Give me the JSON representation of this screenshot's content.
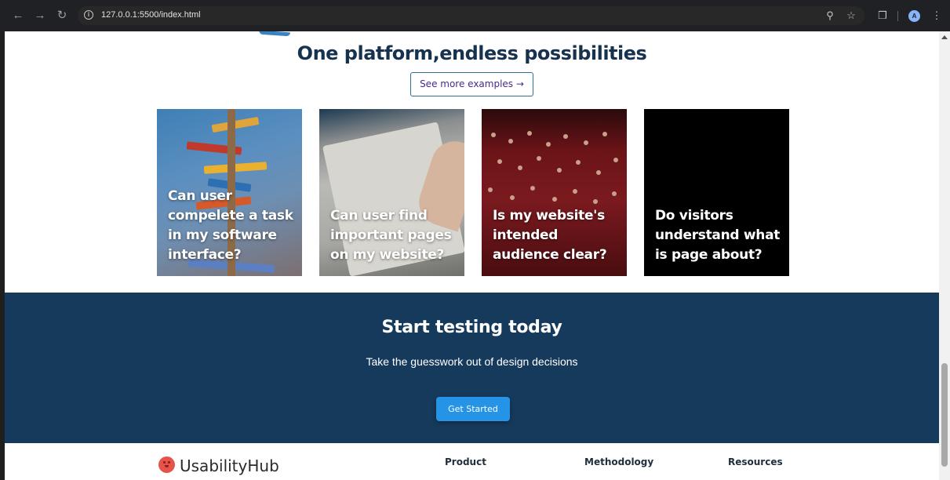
{
  "browser": {
    "url": "127.0.0.1:5500/index.html",
    "avatar_letter": "A"
  },
  "showcase": {
    "title": "One platform,endless possibilities",
    "more_button": "See more examples →",
    "cards": [
      {
        "text": "Can user compelete a task in my software interface?"
      },
      {
        "text": "Can user find important pages on my website?"
      },
      {
        "text": "Is my website's intended audience clear?"
      },
      {
        "text": "Do visitors understand what is page about?"
      }
    ]
  },
  "cta": {
    "title": "Start testing today",
    "subtitle": "Take the guesswork out of design decisions",
    "button": "Get Started",
    "background": "#163a5c",
    "button_color": "#2593e6"
  },
  "footer": {
    "logo_text": "UsabilityHub",
    "links": [
      "Product",
      "Methodology",
      "Resources"
    ]
  }
}
